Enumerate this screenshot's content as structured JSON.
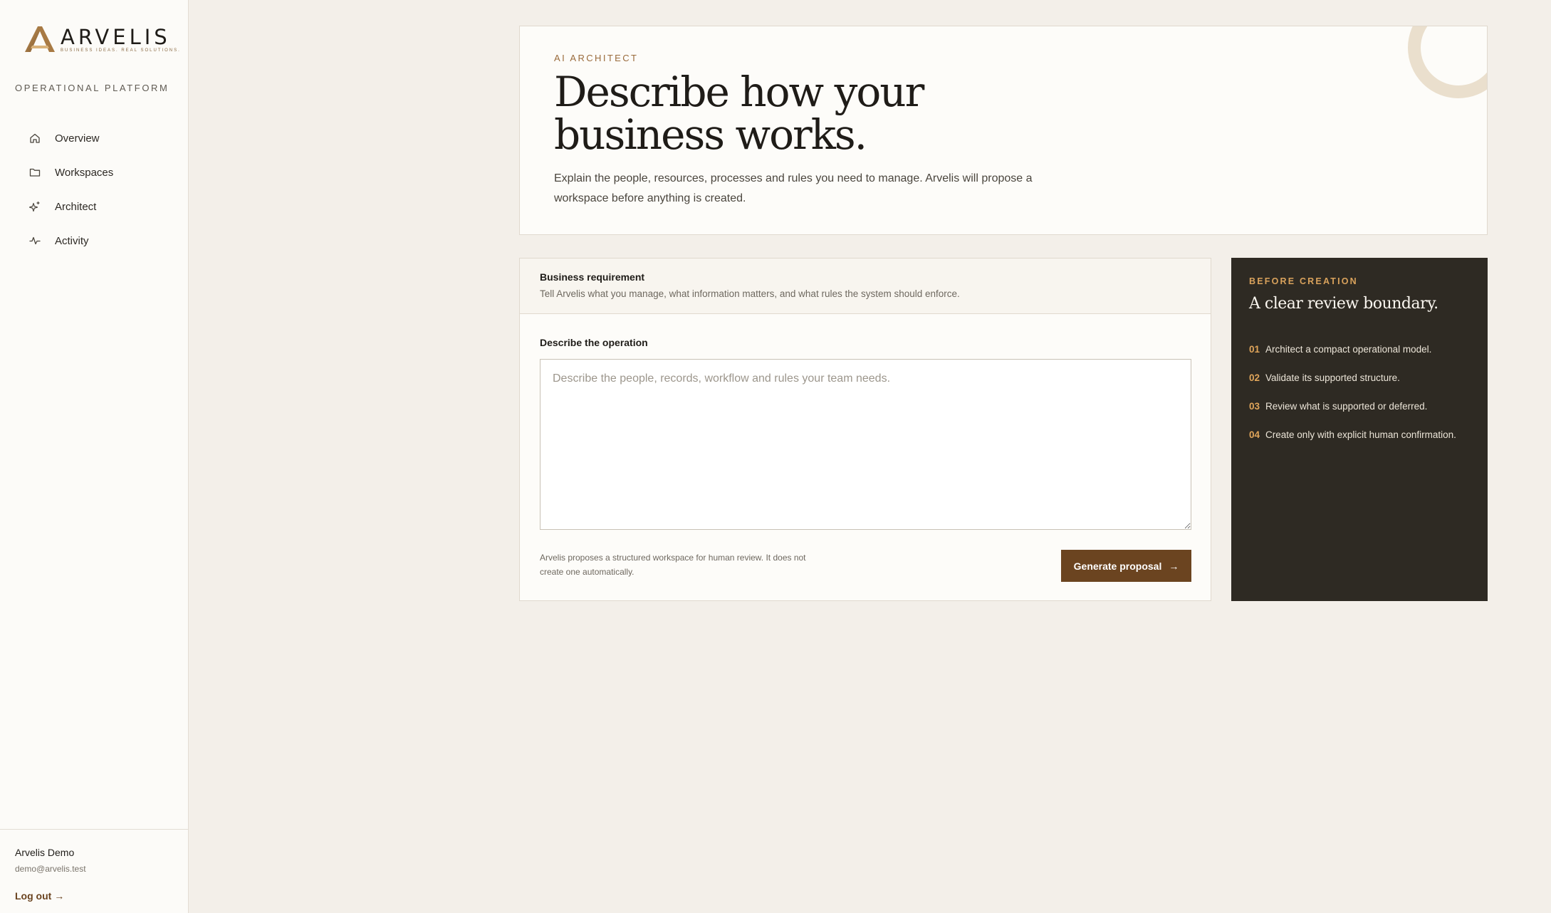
{
  "sidebar": {
    "logo": {
      "word": "ARVELIS",
      "tagline": "BUSINESS IDEAS. REAL SOLUTIONS."
    },
    "platform_label": "OPERATIONAL PLATFORM",
    "items": [
      {
        "label": "Overview",
        "icon": "home-icon"
      },
      {
        "label": "Workspaces",
        "icon": "folder-icon"
      },
      {
        "label": "Architect",
        "icon": "sparkle-icon"
      },
      {
        "label": "Activity",
        "icon": "pulse-icon"
      }
    ],
    "user": {
      "name": "Arvelis Demo",
      "email": "demo@arvelis.test"
    },
    "logout_label": "Log out →"
  },
  "hero": {
    "eyebrow": "AI ARCHITECT",
    "title": "Describe how your business works.",
    "description": "Explain the people, resources, processes and rules you need to manage. Arvelis will propose a workspace before anything is created."
  },
  "form": {
    "header_title": "Business requirement",
    "header_subtitle": "Tell Arvelis what you manage, what information matters, and what rules the system should enforce.",
    "field_label": "Describe the operation",
    "textarea_value": "",
    "textarea_placeholder": "Describe the people, records, workflow and rules your team needs.",
    "note": "Arvelis proposes a structured workspace for human review. It does not create one automatically.",
    "button_label": "Generate proposal",
    "button_arrow": "→"
  },
  "panel": {
    "eyebrow": "BEFORE CREATION",
    "title": "A clear review boundary.",
    "steps": [
      {
        "num": "01",
        "text": "Architect a compact operational model."
      },
      {
        "num": "02",
        "text": "Validate its supported structure."
      },
      {
        "num": "03",
        "text": "Review what is supported or deferred."
      },
      {
        "num": "04",
        "text": "Create only with explicit human confirmation."
      }
    ]
  },
  "colors": {
    "accent": "#6b4420",
    "gold": "#d9a25c",
    "dark_panel": "#2e2a23",
    "background": "#f3efe9"
  }
}
